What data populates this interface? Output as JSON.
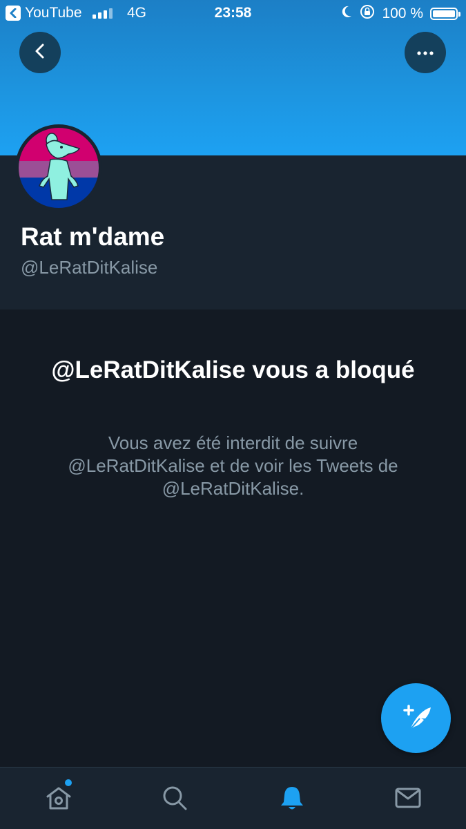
{
  "status_bar": {
    "back_app": "YouTube",
    "network": "4G",
    "time": "23:58",
    "battery": "100 %",
    "battery_level": 1.0
  },
  "profile": {
    "display_name": "Rat m'dame",
    "handle": "@LeRatDitKalise"
  },
  "blocked": {
    "title": "@LeRatDitKalise vous a bloqué",
    "description": "Vous avez été interdit de suivre @LeRatDitKalise et de voir les Tweets de @LeRatDitKalise."
  },
  "header_buttons": {
    "back_icon": "chevron-left-icon",
    "more_icon": "more-horizontal-icon"
  },
  "tab_bar": {
    "items": [
      {
        "icon": "home-icon",
        "active": false,
        "has_badge": true
      },
      {
        "icon": "search-icon",
        "active": false,
        "has_badge": false
      },
      {
        "icon": "bell-icon",
        "active": true,
        "has_badge": false
      },
      {
        "icon": "mail-icon",
        "active": false,
        "has_badge": false
      }
    ]
  },
  "colors": {
    "accent": "#1da1f2",
    "background": "#131a23",
    "header_bg": "#192430",
    "secondary_text": "#8899a6",
    "inactive_icon": "#8899a6"
  }
}
